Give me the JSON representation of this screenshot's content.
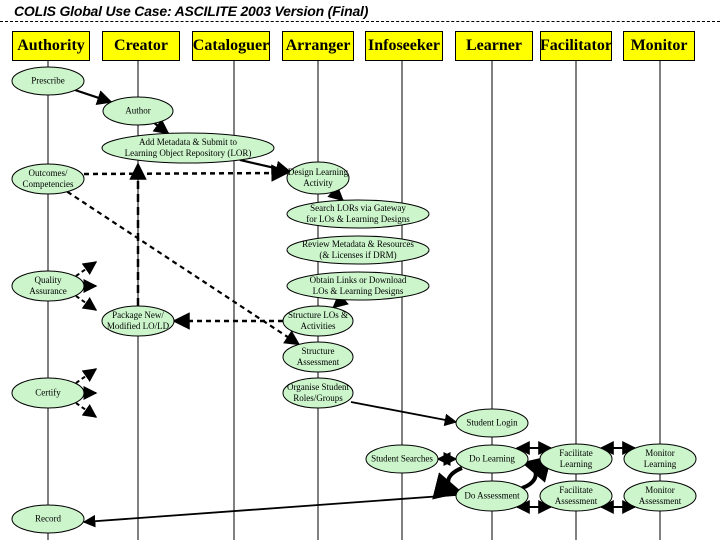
{
  "title": "COLIS Global Use Case: ASCILITE 2003 Version (Final)",
  "colors": {
    "actor_fill": "#ffff00",
    "node_fill": "#ccf5cc",
    "line": "#000000",
    "background": "#ffffff"
  },
  "actors": [
    {
      "id": "authority",
      "label": "Authority"
    },
    {
      "id": "creator",
      "label": "Creator"
    },
    {
      "id": "cataloguer",
      "label": "Cataloguer"
    },
    {
      "id": "arranger",
      "label": "Arranger"
    },
    {
      "id": "infoseeker",
      "label": "Infoseeker"
    },
    {
      "id": "learner",
      "label": "Learner"
    },
    {
      "id": "facilitator",
      "label": "Facilitator"
    },
    {
      "id": "monitor",
      "label": "Monitor"
    }
  ],
  "nodes": [
    {
      "id": "prescribe",
      "actor": "authority",
      "label": "Prescribe"
    },
    {
      "id": "author",
      "actor": "creator",
      "label": "Author"
    },
    {
      "id": "add-metadata",
      "actor": "creator",
      "label": "Add Metadata & Submit to\nLearning Object Repository (LOR)"
    },
    {
      "id": "outcomes",
      "actor": "authority",
      "label": "Outcomes/\nCompetencies"
    },
    {
      "id": "design-learning",
      "actor": "arranger",
      "label": "Design Learning\nActivity"
    },
    {
      "id": "search-lors",
      "actor": "arranger",
      "label": "Search LORs via Gateway\nfor LOs & Learning Designs"
    },
    {
      "id": "review-metadata",
      "actor": "arranger",
      "label": "Review Metadata & Resources\n(& Licenses if DRM)"
    },
    {
      "id": "quality-assurance",
      "actor": "authority",
      "label": "Quality\nAssurance"
    },
    {
      "id": "obtain-links",
      "actor": "arranger",
      "label": "Obtain Links or Download\nLOs & Learning Designs"
    },
    {
      "id": "package-new",
      "actor": "creator",
      "label": "Package New/\nModified LO/LD"
    },
    {
      "id": "structure-los",
      "actor": "arranger",
      "label": "Structure LOs &\nActivities"
    },
    {
      "id": "structure-assessment",
      "actor": "arranger",
      "label": "Structure\nAssessment"
    },
    {
      "id": "certify",
      "actor": "authority",
      "label": "Certify"
    },
    {
      "id": "organise-student",
      "actor": "arranger",
      "label": "Organise Student\nRoles/Groups"
    },
    {
      "id": "student-login",
      "actor": "learner",
      "label": "Student Login"
    },
    {
      "id": "student-searches",
      "actor": "infoseeker",
      "label": "Student Searches"
    },
    {
      "id": "do-learning",
      "actor": "learner",
      "label": "Do Learning"
    },
    {
      "id": "facilitate-learning",
      "actor": "facilitator",
      "label": "Facilitate\nLearning"
    },
    {
      "id": "monitor-learning",
      "actor": "monitor",
      "label": "Monitor\nLearning"
    },
    {
      "id": "do-assessment",
      "actor": "learner",
      "label": "Do Assessment"
    },
    {
      "id": "facilitate-assessment",
      "actor": "facilitator",
      "label": "Facilitate\nAssessment"
    },
    {
      "id": "monitor-assessment",
      "actor": "monitor",
      "label": "Monitor\nAssessment"
    },
    {
      "id": "record",
      "actor": "authority",
      "label": "Record"
    }
  ],
  "edges": [
    {
      "from": "prescribe",
      "to": "author",
      "style": "solid",
      "dir": "forward"
    },
    {
      "from": "author",
      "to": "add-metadata",
      "style": "solid",
      "dir": "forward"
    },
    {
      "from": "add-metadata",
      "to": "design-learning",
      "style": "solid",
      "dir": "forward"
    },
    {
      "from": "outcomes",
      "to": "design-learning",
      "style": "dashed",
      "dir": "forward"
    },
    {
      "from": "outcomes",
      "to": "structure-assessment",
      "style": "dashed",
      "dir": "forward"
    },
    {
      "from": "design-learning",
      "to": "search-lors",
      "style": "solid",
      "dir": "forward"
    },
    {
      "from": "obtain-links",
      "to": "structure-los",
      "style": "solid",
      "dir": "forward"
    },
    {
      "from": "structure-los",
      "to": "package-new",
      "style": "dashed",
      "dir": "forward"
    },
    {
      "from": "package-new",
      "to": "add-metadata",
      "style": "dashed",
      "dir": "forward"
    },
    {
      "from": "quality-assurance",
      "to": "up",
      "style": "dashed",
      "dir": "forward"
    },
    {
      "from": "quality-assurance",
      "to": "right",
      "style": "dashed",
      "dir": "forward"
    },
    {
      "from": "quality-assurance",
      "to": "down",
      "style": "dashed",
      "dir": "forward"
    },
    {
      "from": "certify",
      "to": "up",
      "style": "dashed",
      "dir": "forward"
    },
    {
      "from": "certify",
      "to": "right",
      "style": "dashed",
      "dir": "forward"
    },
    {
      "from": "certify",
      "to": "down",
      "style": "dashed",
      "dir": "forward"
    },
    {
      "from": "organise-student",
      "to": "student-login",
      "style": "solid",
      "dir": "forward"
    },
    {
      "from": "student-searches",
      "to": "do-learning",
      "style": "solid",
      "dir": "both"
    },
    {
      "from": "do-learning",
      "to": "facilitate-learning",
      "style": "solid",
      "dir": "both"
    },
    {
      "from": "facilitate-learning",
      "to": "monitor-learning",
      "style": "solid",
      "dir": "both"
    },
    {
      "from": "do-assessment",
      "to": "facilitate-assessment",
      "style": "solid",
      "dir": "both"
    },
    {
      "from": "facilitate-assessment",
      "to": "monitor-assessment",
      "style": "solid",
      "dir": "both"
    },
    {
      "from": "do-learning",
      "to": "do-assessment",
      "style": "curved",
      "dir": "cycle"
    },
    {
      "from": "do-assessment",
      "to": "record",
      "style": "solid",
      "dir": "forward"
    }
  ]
}
